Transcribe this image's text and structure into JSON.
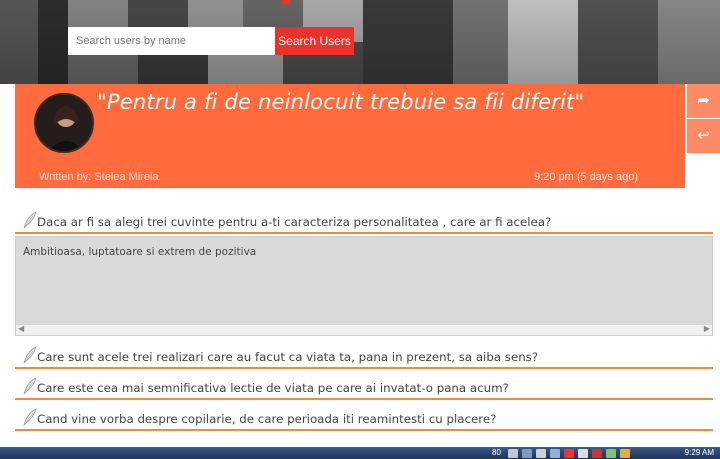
{
  "search": {
    "placeholder": "Search users by name",
    "button_label": "Search Users"
  },
  "post": {
    "title": "\"Pentru a fi de neinlocuit trebuie sa fii diferit\"",
    "author": "Written by: Stelea Mirela",
    "timestamp": "9:20 pm (5 days ago)"
  },
  "side_actions": [
    {
      "icon": "share-icon",
      "glyph": "➦"
    },
    {
      "icon": "reply-icon",
      "glyph": "↩"
    }
  ],
  "questions": [
    {
      "text": "Daca ar fi sa alegi trei cuvinte pentru a-ti caracteriza personalitatea , care ar fi acelea?",
      "answer": "Ambitioasa, luptatoare si extrem de pozitiva"
    },
    {
      "text": "Care sunt acele trei realizari care au facut ca viata ta, pana in prezent, sa aiba sens?"
    },
    {
      "text": "Care este cea mai semnificativa lectie de viata pe care ai invatat-o pana acum?"
    },
    {
      "text": "Cand vine vorba despre copilarie, de care perioada iti reamintesti cu placere?"
    }
  ],
  "taskbar": {
    "tray_number": "80",
    "clock": "9:29 AM"
  },
  "colors": {
    "orange": "#ff6b3d",
    "accent_red": "#e8322a",
    "question_line": "#f08a3c"
  }
}
